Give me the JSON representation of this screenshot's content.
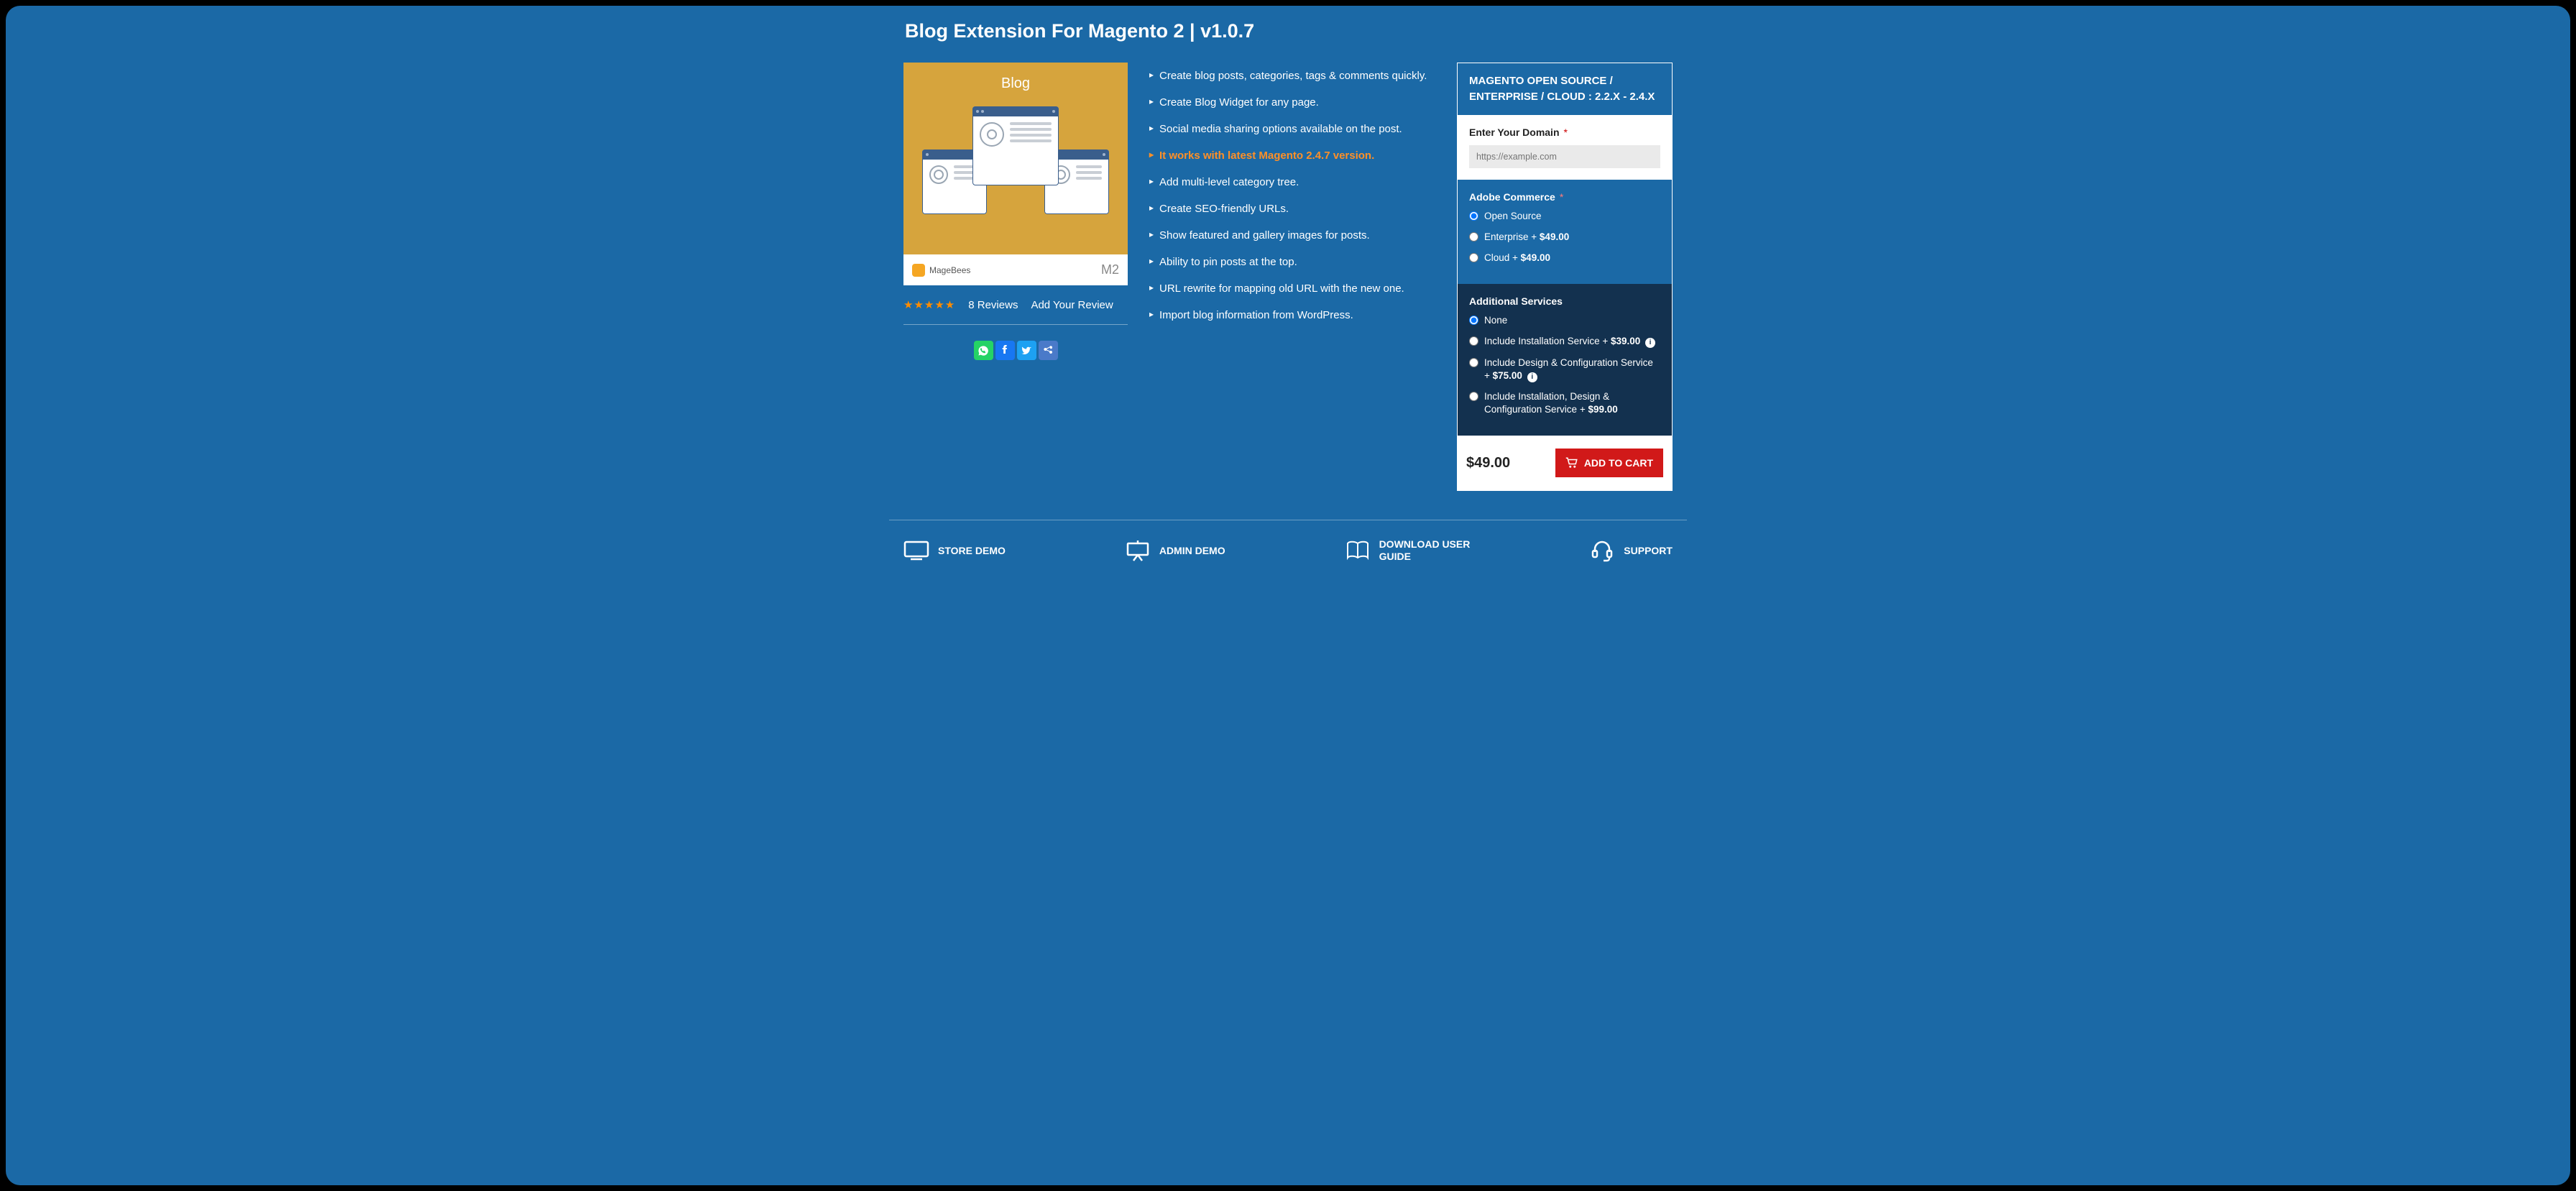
{
  "page": {
    "title": "Blog Extension For Magento 2  |  v1.0.7"
  },
  "product_image": {
    "blog_text": "Blog",
    "brand": "MageBees",
    "badge": "M2"
  },
  "reviews": {
    "stars": "★★★★★",
    "count_label": "8  Reviews",
    "add_label": "Add Your Review"
  },
  "social": {
    "whatsapp": "whatsapp",
    "facebook": "facebook",
    "twitter": "twitter",
    "share": "share"
  },
  "features": [
    {
      "text": "Create blog posts, categories, tags & comments quickly.",
      "highlight": false
    },
    {
      "text": "Create Blog Widget for any page.",
      "highlight": false
    },
    {
      "text": "Social media sharing options available on the post.",
      "highlight": false
    },
    {
      "text": "It works with latest Magento 2.4.7 version.",
      "highlight": true
    },
    {
      "text": "Add multi-level category tree.",
      "highlight": false
    },
    {
      "text": "Create SEO-friendly URLs.",
      "highlight": false
    },
    {
      "text": "Show featured and gallery images for posts.",
      "highlight": false
    },
    {
      "text": "Ability to pin posts at the top.",
      "highlight": false
    },
    {
      "text": "URL rewrite for mapping old URL with the new one.",
      "highlight": false
    },
    {
      "text": "Import blog information from WordPress.",
      "highlight": false
    }
  ],
  "sidebar": {
    "header": "MAGENTO OPEN SOURCE / ENTERPRISE / CLOUD : 2.2.X - 2.4.X",
    "domain_label": "Enter Your Domain",
    "domain_placeholder": "https://example.com",
    "adobe_label": "Adobe Commerce",
    "adobe_options": [
      {
        "label": "Open Source",
        "price": "",
        "checked": true
      },
      {
        "label": "Enterprise + ",
        "price": "$49.00",
        "checked": false
      },
      {
        "label": "Cloud + ",
        "price": "$49.00",
        "checked": false
      }
    ],
    "services_label": "Additional Services",
    "services_options": [
      {
        "label": "None",
        "price": "",
        "checked": true,
        "info": false
      },
      {
        "label": "Include Installation Service + ",
        "price": "$39.00",
        "checked": false,
        "info": true
      },
      {
        "label": "Include Design & Configuration Service + ",
        "price": "$75.00",
        "checked": false,
        "info": true
      },
      {
        "label": "Include Installation, Design & Configuration Service + ",
        "price": "$99.00",
        "checked": false,
        "info": false
      }
    ],
    "price": "$49.00",
    "addcart_label": "ADD TO CART"
  },
  "resources": [
    {
      "label": "STORE DEMO",
      "icon": "monitor"
    },
    {
      "label": "ADMIN DEMO",
      "icon": "easel"
    },
    {
      "label": "DOWNLOAD USER GUIDE",
      "icon": "book"
    },
    {
      "label": "SUPPORT",
      "icon": "headset"
    }
  ]
}
